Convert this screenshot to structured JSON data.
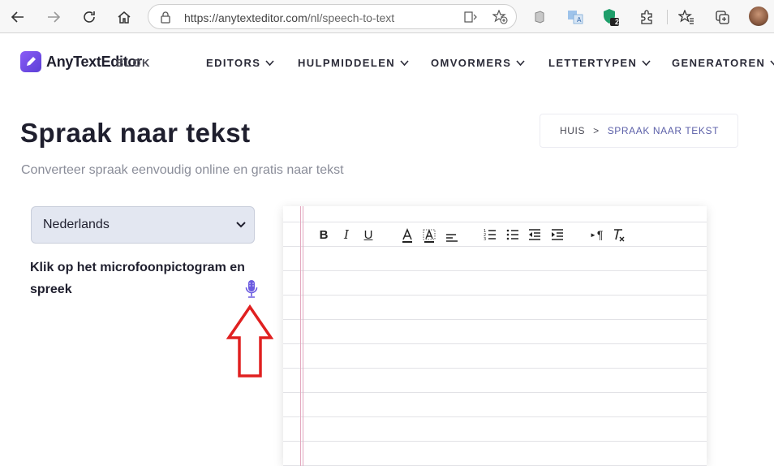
{
  "browser": {
    "url_host": "https://anytexteditor.com",
    "url_path": "/nl/speech-to-text",
    "extension_badge": "2"
  },
  "site": {
    "logo_text": "AnyTextEditor",
    "logo_overlap_text": "BLOK",
    "menu": [
      {
        "label": "EDITORS"
      },
      {
        "label": "HULPMIDDELEN"
      },
      {
        "label": "OMVORMERS"
      },
      {
        "label": "LETTERTYPEN"
      },
      {
        "label": "GENERATOREN"
      }
    ]
  },
  "page": {
    "title": "Spraak naar tekst",
    "subtitle": "Converteer spraak eenvoudig online en gratis naar tekst",
    "breadcrumb": {
      "home": "HUIS",
      "separator": ">",
      "current": "SPRAAK NAAR TEKST"
    }
  },
  "controls": {
    "language_selected": "Nederlands",
    "instruction": "Klik op het microfoonpictogram en spreek"
  },
  "toolbar": {
    "bold": "B",
    "italic": "I",
    "underline": "U",
    "paragraph": "¶"
  },
  "colors": {
    "accent": "#5b5fa8",
    "mic": "#6b5be0",
    "arrow": "#e02020",
    "margin_line": "#e3a9c0"
  }
}
